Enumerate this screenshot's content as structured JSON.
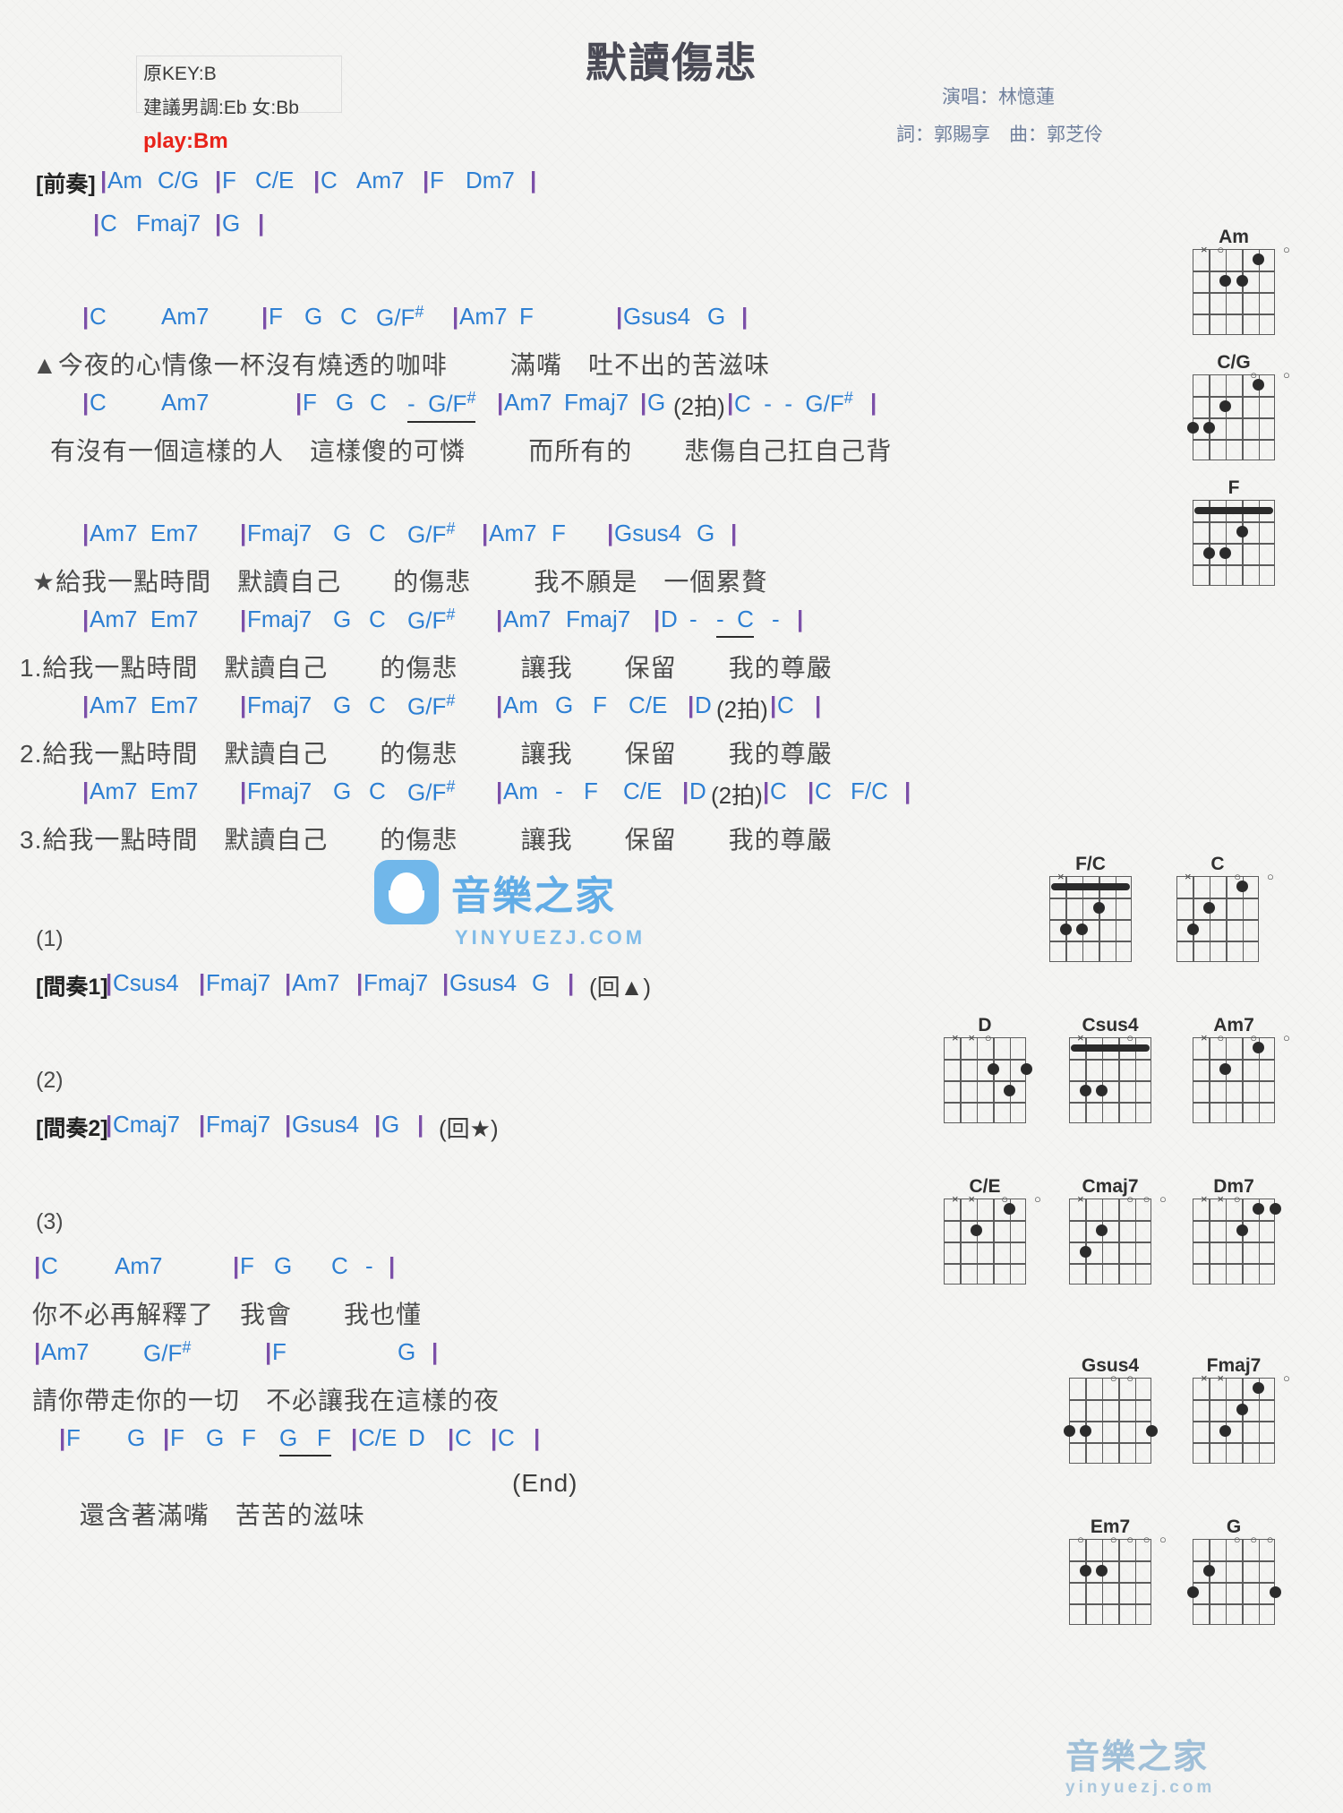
{
  "header": {
    "title": "默讀傷悲",
    "key_original": "原KEY:B",
    "key_suggested": "建議男調:Eb 女:Bb",
    "key_play": "play:Bm",
    "singer": "演唱：林憶蓮",
    "writers": "詞：郭賜享　曲：郭芝伶",
    "play_color": "#e8231a",
    "chord_color": "#2d7fd3",
    "bar_color": "#7b4fa8"
  },
  "sections": {
    "intro_label": "[前奏]",
    "interlude1_label": "[間奏1]",
    "interlude2_label": "[間奏2]",
    "marker_1": "(1)",
    "marker_2": "(2)",
    "marker_3": "(3)",
    "end_label": "(End)",
    "repeat_triangle": "(回▲)",
    "repeat_star": "(回★)"
  },
  "lines": {
    "intro_a": "|Am   C/G    |F   C/E   |C   Am7    |F   Dm7    |",
    "intro_b": "|C   Fmaj7   |G   |",
    "v1_chords": "|C        Am7        |F   G   C   G/F#   |Am7   F        |Gsus4   G   |",
    "v1_lyrics": "▲今夜的心情像一杯沒有燒透的咖啡        滿嘴　吐不出的苦滋味",
    "v2_chords": "|C        Am7        |F   G   C   -  G/F#   |Am7   Fmaj7   |G (2拍)|C  -  -  G/F#   |",
    "v2_lyrics": "有沒有一個這樣的人　這樣傻的可憐        而所有的　　悲傷自己扛自己背",
    "ch_chords": "|Am7   Em7     |Fmaj7   G   C   G/F#   |Am7   F      |Gsus4   G   |",
    "ch_lyrics": "★給我一點時間　默讀自己　　的傷悲        我不願是　一個累贅",
    "e1_chords": "|Am7   Em7     |Fmaj7   G   C   G/F#    |Am7   Fmaj7   |D  -  -  C  - |",
    "e1_lyrics": "1.給我一點時間　默讀自己　　的傷悲        讓我　　保留　　我的尊嚴",
    "e2_chords": "|Am7   Em7     |Fmaj7   G   C   G/F#    |Am   G   F   C/E    |D (2拍)|C   |",
    "e2_lyrics": "2.給我一點時間　默讀自己　　的傷悲        讓我　　保留　　我的尊嚴",
    "e3_chords": "|Am7   Em7     |Fmaj7   G   C   G/F#    |Am  -  F   C/E   |D (2拍)|C   |C   F/C   |",
    "e3_lyrics": "3.給我一點時間　默讀自己　　的傷悲        讓我　　保留　　我的尊嚴",
    "int1_chords": "|Csus4   |Fmaj7   |Am7   |Fmaj7   |Gsus4   G   |",
    "int2_chords": "|Cmaj7   |Fmaj7   |Gsus4   |G   |",
    "o1_chords": "|C        Am7        |F   G     C   - |",
    "o1_lyrics": "你不必再解釋了　我會　　我也懂",
    "o2_chords": "|Am7        G/F#        |F                G   |",
    "o2_lyrics": "請你帶走你的一切　不必讓我在這樣的夜",
    "o3_chords": "|F     G  |F   G   F   G   F  |C/E   D   |C   |C   |",
    "o3_lyrics": "還含著滿嘴　苦苦的滋味"
  },
  "diagrams": [
    {
      "name": "Am",
      "frets": "x02210",
      "fingers": [
        [
          2,
          4
        ],
        [
          2,
          3
        ],
        [
          1,
          2
        ]
      ]
    },
    {
      "name": "C/G",
      "frets": "332010",
      "fingers": [
        [
          3,
          6
        ],
        [
          3,
          5
        ],
        [
          2,
          4
        ],
        [
          1,
          2
        ]
      ]
    },
    {
      "name": "F",
      "frets": "133211",
      "fingers": [
        [
          1,
          "barre"
        ],
        [
          3,
          5
        ],
        [
          2,
          3
        ],
        [
          3,
          4
        ]
      ]
    },
    {
      "name": "F/C",
      "frets": "x33211",
      "fingers": [
        [
          1,
          "barre"
        ],
        [
          3,
          5
        ],
        [
          2,
          3
        ],
        [
          3,
          4
        ]
      ]
    },
    {
      "name": "C",
      "frets": "x32010",
      "fingers": [
        [
          3,
          5
        ],
        [
          2,
          4
        ],
        [
          1,
          2
        ]
      ]
    },
    {
      "name": "D",
      "frets": "xx0232",
      "fingers": [
        [
          2,
          3
        ],
        [
          3,
          2
        ],
        [
          2,
          1
        ]
      ]
    },
    {
      "name": "Csus4",
      "frets": "x33011",
      "fingers": [
        [
          1,
          "barre"
        ],
        [
          3,
          5
        ],
        [
          3,
          4
        ]
      ]
    },
    {
      "name": "Am7",
      "frets": "x02010",
      "fingers": [
        [
          2,
          4
        ],
        [
          1,
          2
        ]
      ]
    },
    {
      "name": "C/E",
      "frets": "xx2010",
      "fingers": [
        [
          2,
          4
        ],
        [
          1,
          2
        ]
      ]
    },
    {
      "name": "Cmaj7",
      "frets": "x32000",
      "fingers": [
        [
          3,
          5
        ],
        [
          2,
          4
        ]
      ]
    },
    {
      "name": "Dm7",
      "frets": "xx0211",
      "fingers": [
        [
          2,
          3
        ],
        [
          1,
          2
        ],
        [
          1,
          1
        ]
      ]
    },
    {
      "name": "Gsus4",
      "frets": "330013",
      "fingers": [
        [
          3,
          6
        ],
        [
          3,
          5
        ],
        [
          3,
          1
        ]
      ]
    },
    {
      "name": "Fmaj7",
      "frets": "xx3210",
      "fingers": [
        [
          3,
          4
        ],
        [
          2,
          3
        ],
        [
          1,
          2
        ]
      ]
    },
    {
      "name": "Em7",
      "frets": "020000",
      "fingers": [
        [
          2,
          5
        ],
        [
          2,
          4
        ]
      ]
    },
    {
      "name": "G",
      "frets": "320003",
      "fingers": [
        [
          3,
          6
        ],
        [
          2,
          5
        ],
        [
          3,
          1
        ]
      ]
    }
  ],
  "watermark": {
    "brand": "音樂之家",
    "site": "YINYUEZJ.COM",
    "site_lower": "yinyuezj.com"
  }
}
